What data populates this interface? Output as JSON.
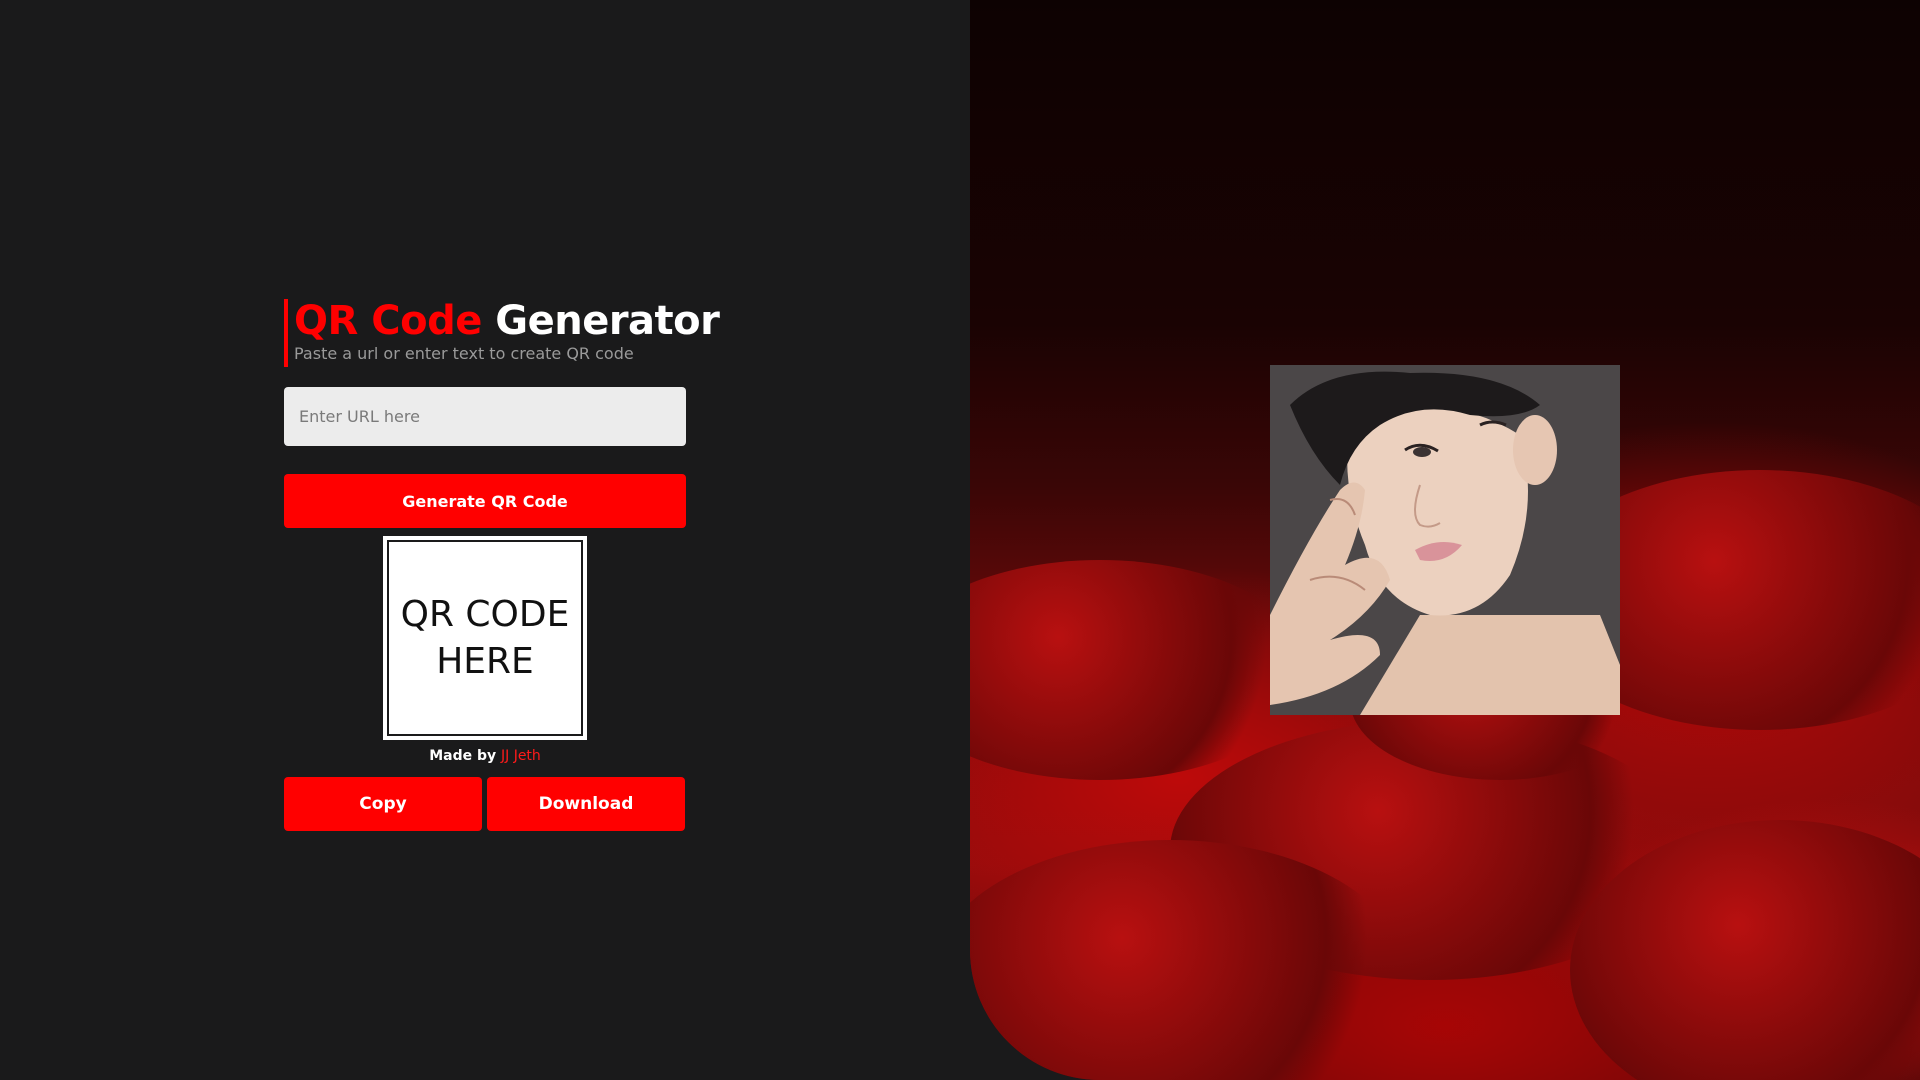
{
  "header": {
    "title_accent": "QR Code",
    "title_rest": "Generator",
    "subtitle": "Paste a url or enter text to create QR code"
  },
  "url_input": {
    "placeholder": "Enter URL here",
    "value": ""
  },
  "generate_button": {
    "label": "Generate QR Code"
  },
  "qr_placeholder": {
    "text": "QR CODE\nHERE"
  },
  "credit": {
    "prefix": "Made by ",
    "author": "JJ Jeth"
  },
  "actions": {
    "copy_label": "Copy",
    "download_label": "Download"
  },
  "colors": {
    "accent": "#ff0000",
    "background": "#1a1a1b",
    "input_bg": "#ececec",
    "clouds": "#8a0c0c"
  },
  "images": {
    "background": "red-clouds-illustration",
    "portrait": "illustrated-portrait"
  }
}
